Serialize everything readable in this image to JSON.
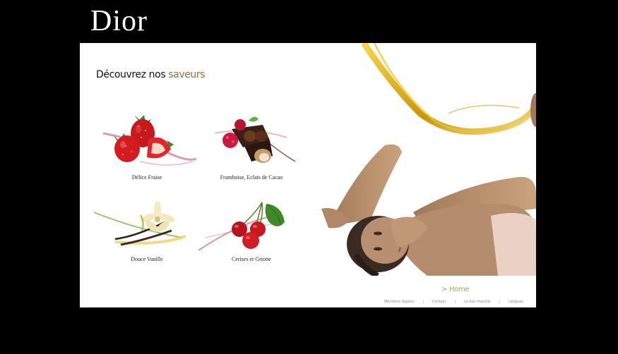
{
  "brand": {
    "logo_text": "Dior"
  },
  "main": {
    "heading_prefix": "Découvrez nos ",
    "heading_accent": "saveurs",
    "flavors": [
      {
        "label": "Délice Fraise"
      },
      {
        "label": "Framboise, Eclats de Cacao"
      },
      {
        "label": "Douce Vanille"
      },
      {
        "label": "Cerises et Griotte"
      }
    ]
  },
  "nav": {
    "home_label": "> Home"
  },
  "footer": {
    "links": [
      "Mentions légales",
      "Contact",
      "Le bon marché",
      "Langues"
    ],
    "separator": "|"
  },
  "colors": {
    "accent": "#8b6f3e",
    "home": "#b59a5c",
    "background": "#000000"
  }
}
